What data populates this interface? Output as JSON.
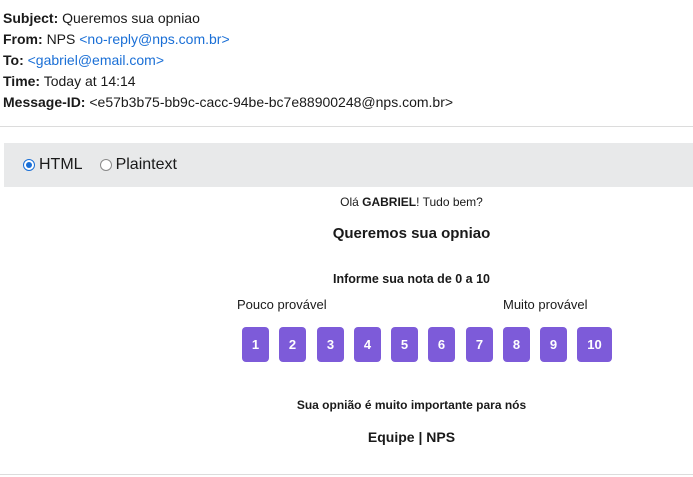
{
  "email": {
    "subject_label": "Subject:",
    "subject": "Queremos sua opniao",
    "from_label": "From:",
    "from_name": "NPS",
    "from_address": "<no-reply@nps.com.br>",
    "to_label": "To:",
    "to_address": "<gabriel@email.com>",
    "time_label": "Time:",
    "time": "Today at 14:14",
    "message_id_label": "Message-ID:",
    "message_id": "<e57b3b75-bb9c-cacc-94be-bc7e88900248@nps.com.br>"
  },
  "view_toggle": {
    "html_label": "HTML",
    "plaintext_label": "Plaintext",
    "selected": "HTML"
  },
  "body": {
    "greeting_prefix": "Olá ",
    "greeting_name": "GABRIEL",
    "greeting_suffix": "! Tudo bem?",
    "headline": "Queremos sua opniao",
    "prompt": "Informe sua nota de 0 a 10",
    "low_label": "Pouco provável",
    "high_label": "Muito provável",
    "scores": [
      "1",
      "2",
      "3",
      "4",
      "5",
      "6",
      "7",
      "8",
      "9",
      "10"
    ],
    "closing": "Sua opnião é muito importante para nós",
    "signature": "Equipe | NPS"
  },
  "colors": {
    "score_button": "#7d5bd9",
    "link": "#1a6fd6",
    "tab_bar": "#e8e9ea"
  }
}
